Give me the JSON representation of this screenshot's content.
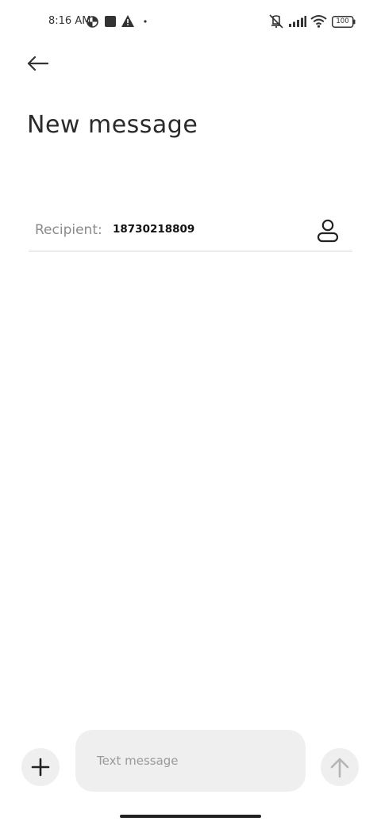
{
  "status_bar": {
    "time": "8:16 AM",
    "battery_level": "100",
    "icons": [
      "data-saver-icon",
      "square-notification-icon",
      "warning-icon",
      "dot-icon",
      "vibrate-off-icon",
      "signal-icon",
      "wifi-icon",
      "battery-icon"
    ]
  },
  "header": {
    "back_icon": "arrow-left-icon",
    "title": "New message"
  },
  "recipient": {
    "label": "Recipient:",
    "value": "18730218809",
    "contact_icon": "person-icon"
  },
  "composer": {
    "add_icon": "plus-icon",
    "placeholder": "Text message",
    "send_icon": "arrow-up-icon"
  }
}
